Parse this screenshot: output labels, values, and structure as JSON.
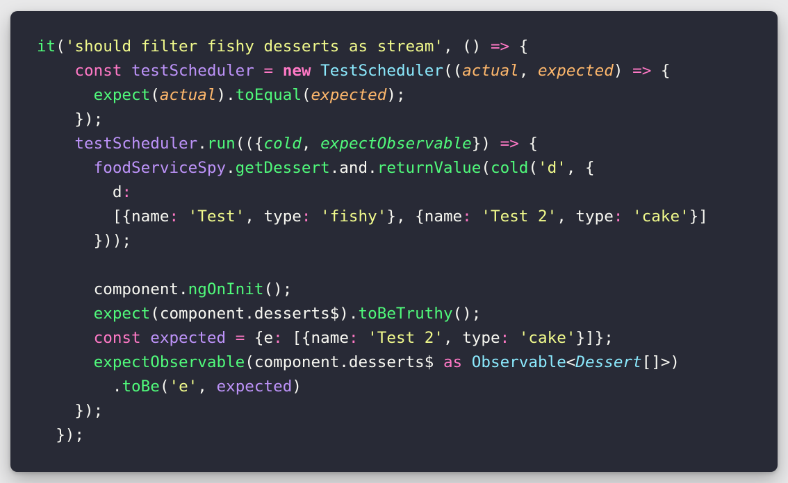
{
  "theme": {
    "background": "#282a36",
    "page_background": "#e9e9ea",
    "colors": {
      "plain": "#f8f8f2",
      "function": "#50fa7b",
      "string": "#f1fa8c",
      "keyword": "#ff79c6",
      "variable": "#bd93f9",
      "class": "#8be9fd",
      "parameter": "#ffb86c"
    }
  },
  "code": {
    "language": "typescript",
    "lines": [
      {
        "tokens": [
          {
            "text": "it",
            "kind": "function"
          },
          {
            "text": "(",
            "kind": "plain"
          },
          {
            "text": "'should filter fishy desserts as stream'",
            "kind": "string"
          },
          {
            "text": ", () ",
            "kind": "plain"
          },
          {
            "text": "=>",
            "kind": "keyword"
          },
          {
            "text": " {",
            "kind": "plain"
          }
        ]
      },
      {
        "tokens": [
          {
            "text": "    ",
            "kind": "plain"
          },
          {
            "text": "const",
            "kind": "keyword"
          },
          {
            "text": " ",
            "kind": "plain"
          },
          {
            "text": "testScheduler",
            "kind": "variable"
          },
          {
            "text": " ",
            "kind": "plain"
          },
          {
            "text": "=",
            "kind": "keyword"
          },
          {
            "text": " ",
            "kind": "plain"
          },
          {
            "text": "new",
            "kind": "keyword",
            "bold": true
          },
          {
            "text": " ",
            "kind": "plain"
          },
          {
            "text": "TestScheduler",
            "kind": "class"
          },
          {
            "text": "((",
            "kind": "plain"
          },
          {
            "text": "actual",
            "kind": "parameter",
            "italic": true
          },
          {
            "text": ", ",
            "kind": "plain"
          },
          {
            "text": "expected",
            "kind": "parameter",
            "italic": true
          },
          {
            "text": ") ",
            "kind": "plain"
          },
          {
            "text": "=>",
            "kind": "keyword"
          },
          {
            "text": " {",
            "kind": "plain"
          }
        ]
      },
      {
        "tokens": [
          {
            "text": "      ",
            "kind": "plain"
          },
          {
            "text": "expect",
            "kind": "function"
          },
          {
            "text": "(",
            "kind": "plain"
          },
          {
            "text": "actual",
            "kind": "parameter",
            "italic": true
          },
          {
            "text": ").",
            "kind": "plain"
          },
          {
            "text": "toEqual",
            "kind": "function"
          },
          {
            "text": "(",
            "kind": "plain"
          },
          {
            "text": "expected",
            "kind": "parameter",
            "italic": true
          },
          {
            "text": ");",
            "kind": "plain"
          }
        ]
      },
      {
        "tokens": [
          {
            "text": "    });",
            "kind": "plain"
          }
        ]
      },
      {
        "tokens": [
          {
            "text": "    ",
            "kind": "plain"
          },
          {
            "text": "testScheduler",
            "kind": "variable"
          },
          {
            "text": ".",
            "kind": "plain"
          },
          {
            "text": "run",
            "kind": "function"
          },
          {
            "text": "(({",
            "kind": "plain"
          },
          {
            "text": "cold",
            "kind": "function",
            "italic": true
          },
          {
            "text": ", ",
            "kind": "plain"
          },
          {
            "text": "expectObservable",
            "kind": "function",
            "italic": true
          },
          {
            "text": "}) ",
            "kind": "plain"
          },
          {
            "text": "=>",
            "kind": "keyword"
          },
          {
            "text": " {",
            "kind": "plain"
          }
        ]
      },
      {
        "tokens": [
          {
            "text": "      ",
            "kind": "plain"
          },
          {
            "text": "foodServiceSpy",
            "kind": "variable"
          },
          {
            "text": ".",
            "kind": "plain"
          },
          {
            "text": "getDessert",
            "kind": "function"
          },
          {
            "text": ".and.",
            "kind": "plain"
          },
          {
            "text": "returnValue",
            "kind": "function"
          },
          {
            "text": "(",
            "kind": "plain"
          },
          {
            "text": "cold",
            "kind": "function"
          },
          {
            "text": "(",
            "kind": "plain"
          },
          {
            "text": "'d'",
            "kind": "string"
          },
          {
            "text": ", {",
            "kind": "plain"
          }
        ]
      },
      {
        "tokens": [
          {
            "text": "        d",
            "kind": "plain"
          },
          {
            "text": ":",
            "kind": "keyword"
          }
        ]
      },
      {
        "tokens": [
          {
            "text": "        [{name",
            "kind": "plain"
          },
          {
            "text": ":",
            "kind": "keyword"
          },
          {
            "text": " ",
            "kind": "plain"
          },
          {
            "text": "'Test'",
            "kind": "string"
          },
          {
            "text": ", type",
            "kind": "plain"
          },
          {
            "text": ":",
            "kind": "keyword"
          },
          {
            "text": " ",
            "kind": "plain"
          },
          {
            "text": "'fishy'",
            "kind": "string"
          },
          {
            "text": "}, {name",
            "kind": "plain"
          },
          {
            "text": ":",
            "kind": "keyword"
          },
          {
            "text": " ",
            "kind": "plain"
          },
          {
            "text": "'Test 2'",
            "kind": "string"
          },
          {
            "text": ", type",
            "kind": "plain"
          },
          {
            "text": ":",
            "kind": "keyword"
          },
          {
            "text": " ",
            "kind": "plain"
          },
          {
            "text": "'cake'",
            "kind": "string"
          },
          {
            "text": "}]",
            "kind": "plain"
          }
        ]
      },
      {
        "tokens": [
          {
            "text": "      }));",
            "kind": "plain"
          }
        ]
      },
      {
        "tokens": [
          {
            "text": "",
            "kind": "plain"
          }
        ]
      },
      {
        "tokens": [
          {
            "text": "      component.",
            "kind": "plain"
          },
          {
            "text": "ngOnInit",
            "kind": "function"
          },
          {
            "text": "();",
            "kind": "plain"
          }
        ]
      },
      {
        "tokens": [
          {
            "text": "      ",
            "kind": "plain"
          },
          {
            "text": "expect",
            "kind": "function"
          },
          {
            "text": "(component.desserts$).",
            "kind": "plain"
          },
          {
            "text": "toBeTruthy",
            "kind": "function"
          },
          {
            "text": "();",
            "kind": "plain"
          }
        ]
      },
      {
        "tokens": [
          {
            "text": "      ",
            "kind": "plain"
          },
          {
            "text": "const",
            "kind": "keyword"
          },
          {
            "text": " ",
            "kind": "plain"
          },
          {
            "text": "expected",
            "kind": "variable"
          },
          {
            "text": " ",
            "kind": "plain"
          },
          {
            "text": "=",
            "kind": "keyword"
          },
          {
            "text": " {e",
            "kind": "plain"
          },
          {
            "text": ":",
            "kind": "keyword"
          },
          {
            "text": " [{name",
            "kind": "plain"
          },
          {
            "text": ":",
            "kind": "keyword"
          },
          {
            "text": " ",
            "kind": "plain"
          },
          {
            "text": "'Test 2'",
            "kind": "string"
          },
          {
            "text": ", type",
            "kind": "plain"
          },
          {
            "text": ":",
            "kind": "keyword"
          },
          {
            "text": " ",
            "kind": "plain"
          },
          {
            "text": "'cake'",
            "kind": "string"
          },
          {
            "text": "}]};",
            "kind": "plain"
          }
        ]
      },
      {
        "tokens": [
          {
            "text": "      ",
            "kind": "plain"
          },
          {
            "text": "expectObservable",
            "kind": "function"
          },
          {
            "text": "(component.desserts$ ",
            "kind": "plain"
          },
          {
            "text": "as",
            "kind": "keyword"
          },
          {
            "text": " ",
            "kind": "plain"
          },
          {
            "text": "Observable",
            "kind": "class"
          },
          {
            "text": "<",
            "kind": "plain"
          },
          {
            "text": "Dessert",
            "kind": "class",
            "italic": true
          },
          {
            "text": "[]>)",
            "kind": "plain"
          }
        ]
      },
      {
        "tokens": [
          {
            "text": "        .",
            "kind": "plain"
          },
          {
            "text": "toBe",
            "kind": "function"
          },
          {
            "text": "(",
            "kind": "plain"
          },
          {
            "text": "'e'",
            "kind": "string"
          },
          {
            "text": ", ",
            "kind": "plain"
          },
          {
            "text": "expected",
            "kind": "variable"
          },
          {
            "text": ")",
            "kind": "plain"
          }
        ]
      },
      {
        "tokens": [
          {
            "text": "    });",
            "kind": "plain"
          }
        ]
      },
      {
        "tokens": [
          {
            "text": "  });",
            "kind": "plain"
          }
        ]
      }
    ]
  }
}
